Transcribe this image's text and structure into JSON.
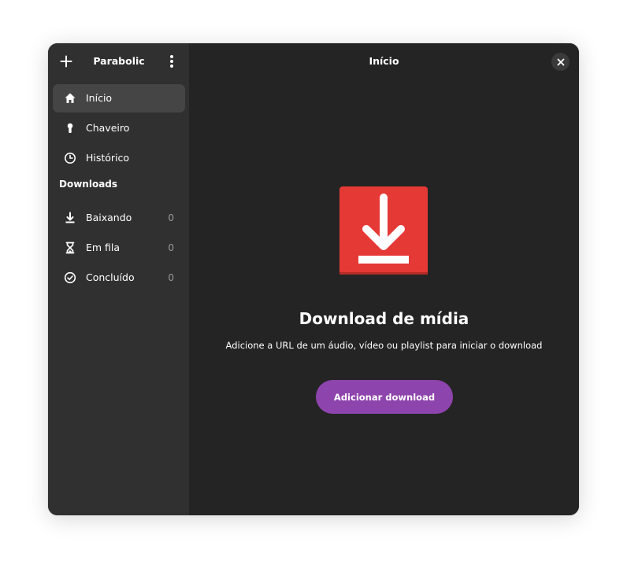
{
  "sidebar": {
    "title": "Parabolic",
    "items": [
      {
        "label": "Início",
        "icon": "home-icon"
      },
      {
        "label": "Chaveiro",
        "icon": "keyring-icon"
      },
      {
        "label": "Histórico",
        "icon": "clock-icon"
      }
    ],
    "downloads_section": "Downloads",
    "download_items": [
      {
        "label": "Baixando",
        "count": "0",
        "icon": "download-arrow-icon"
      },
      {
        "label": "Em fila",
        "count": "0",
        "icon": "hourglass-icon"
      },
      {
        "label": "Concluído",
        "count": "0",
        "icon": "check-circle-icon"
      }
    ]
  },
  "main": {
    "title": "Início",
    "hero_title": "Download de mídia",
    "hero_subtitle": "Adicione a URL de um áudio, vídeo ou playlist para iniciar o download",
    "add_button": "Adicionar download"
  },
  "colors": {
    "accent": "#8e44ad",
    "hero_icon": "#e53935",
    "sidebar_bg": "#303030",
    "main_bg": "#242424"
  }
}
